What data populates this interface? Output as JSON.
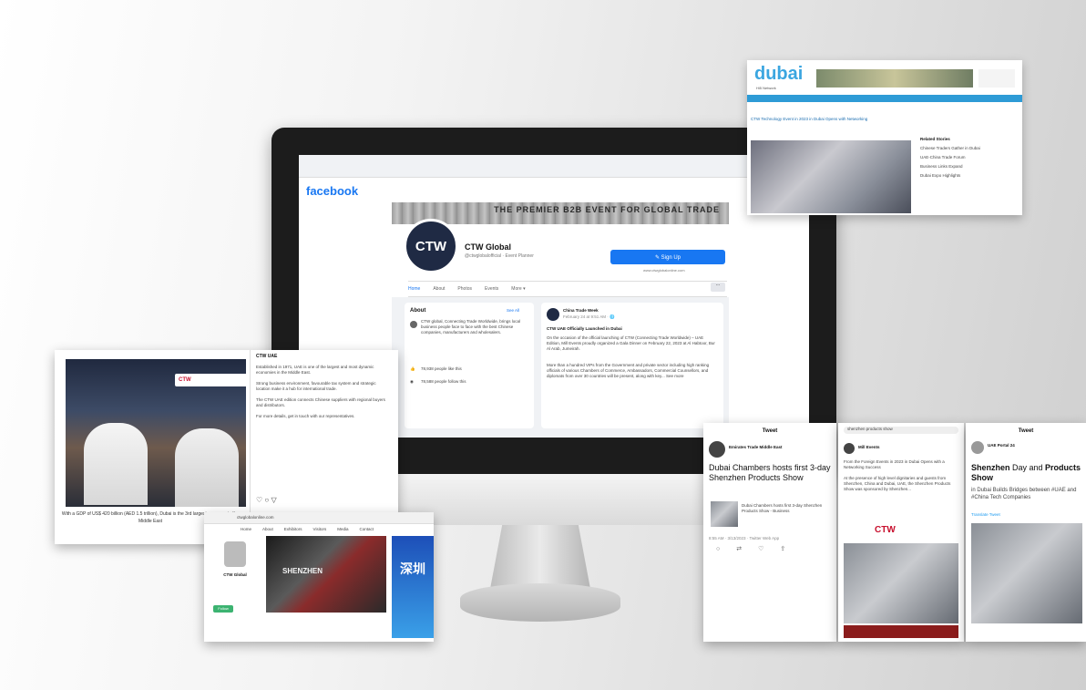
{
  "monitor": {
    "facebook": {
      "logo": "facebook",
      "cover_text": "THE PREMIER B2B EVENT FOR GLOBAL TRADE",
      "avatar_text": "CTW",
      "page_name": "CTW Global",
      "page_sub": "@ctwglobalofficial · Event Planner",
      "signup_label": "✎ Sign Up",
      "website": "www.ctwglobalonline.com",
      "tabs": [
        "Home",
        "About",
        "Photos",
        "Events",
        "More ▾"
      ],
      "more_btn": "···",
      "about": {
        "title": "About",
        "see_all": "See All",
        "description": "CTW global, Connecting Trade Worldwide, brings local business people face to face with the best Chinese companies, manufacturers and wholesalers.",
        "likes": "78,938 people like this",
        "follows": "78,588 people follow this"
      },
      "post": {
        "author": "China Trade Week",
        "date": "February 24 at 9:51 AM · 🌐",
        "headline": "CTW UAE Officially Launched in Dubai",
        "body1": "On the occasion of the official launching of CTW (Connecting Trade Worldwide) – UAE Edition, Mill Events proudly organized a Gala Dinner on February 22, 2023 at Al Habtoor, Bur Al Arab, Jumeirah.",
        "body2": "More than a hundred VIPs from the Government and private sector including high ranking officials of various Chambers of Commerce, Ambassadors, Commercial Counsellors, and diplomats from over 30 countries will be present, along with key... See more"
      }
    }
  },
  "dubai_article": {
    "logo": "dubai",
    "sublogo": "Hi5 Network",
    "headline": "CTW Technology Event in 2023 in Dubai Opens with Networking",
    "sidebar_title": "Related Stories",
    "side_items": [
      "Chinese Traders Gather in Dubai",
      "UAE-China Trade Forum",
      "Business Links Expand",
      "Dubai Expo Highlights"
    ]
  },
  "left_post": {
    "logo": "CTW",
    "caption": "With a GDP of US$ 420 billion (AED 1.5 trillion), Dubai is the 3rd largest economy in the Middle East",
    "title": "CTW UAE",
    "paragraphs": [
      "Established in 1971, UAE is one of the largest and most dynamic economies in the Middle East.",
      "Strong business environment, favourable tax system and strategic location make it a hub for international trade.",
      "The CTW UAE edition connects Chinese suppliers with regional buyers and distributors.",
      "For more details, get in touch with our representatives."
    ]
  },
  "browser": {
    "url": "ctwglobalonline.com",
    "tabs": [
      "Home",
      "About",
      "Exhibitors",
      "Visitors",
      "Media",
      "Contact"
    ],
    "video_title": "SHENZHEN",
    "banner_text": "深圳",
    "profile_name": "CTW Global",
    "follow": "Follow"
  },
  "tweets": [
    {
      "header": "Tweet",
      "author": "Emirates Trade Middle East",
      "big_text": "Dubai Chambers hosts first 3-day Shenzhen Products Show",
      "link_title": "Dubai Chambers hosts first 3-day Shenzhen Products Show - Business",
      "time": "8:55 AM · 3/13/2023 · Twitter Web App"
    },
    {
      "header": "Tweet",
      "search": "shenzhen products show",
      "author": "Mill Events",
      "body": "From the Foreign Events in 2023 in Dubai Opens with a Networking Success",
      "body2": "At the presence of high level dignitaries and guests from Shenzhen, China and Dubai, UAE, the Shenzhen Products Show was sponsored by Shenzhen...",
      "logo": "CTW"
    },
    {
      "header": "Tweet",
      "author": "UAE Portal 24",
      "big_prefix": "Shenzhen",
      "big_mid": " Day and ",
      "big_bold": "Products Show",
      "body": "in Dubai Builds Bridges between #UAE and #China Tech Companies",
      "tag": "Translate Tweet"
    }
  ]
}
